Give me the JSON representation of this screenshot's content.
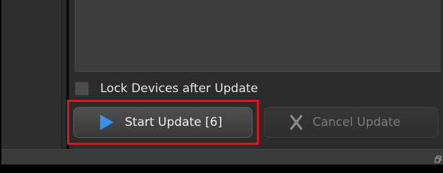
{
  "options": {
    "lock_devices_label": "Lock Devices after Update",
    "lock_devices_checked": false
  },
  "actions": {
    "start_update_label": "Start Update [6]",
    "start_update_icon": "play-icon",
    "cancel_update_label": "Cancel Update",
    "cancel_update_icon": "close-x-icon",
    "cancel_enabled": false
  },
  "colors": {
    "play_icon": "#3a8fe8",
    "highlight_border": "#e0141d",
    "panel_bg": "#2b2b2b",
    "log_bg": "#3d3d3d"
  },
  "status_bar": {
    "corner_icon": "window-restore-icon"
  }
}
